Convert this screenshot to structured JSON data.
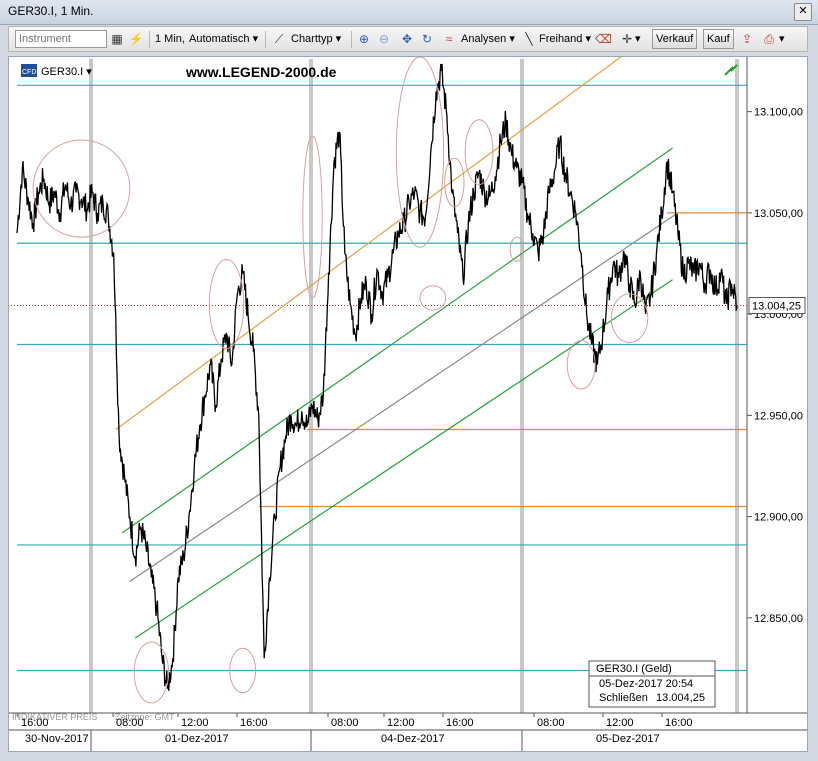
{
  "window": {
    "title": "GER30.I, 1 Min.",
    "close_glyph": "✕"
  },
  "toolbar": {
    "instrument_placeholder": "Instrument",
    "period": "1 Min,",
    "scale": "Automatisch",
    "charttype": "Charttyp",
    "analysen": "Analysen",
    "freihand": "Freihand",
    "verkauf": "Verkauf",
    "kauf": "Kauf",
    "icons": [
      "table-icon",
      "indicator-icon",
      "line-chart-icon",
      "zoom-in-icon",
      "zoom-out-icon",
      "fit-icon",
      "refresh-icon",
      "analysis-icon",
      "freehand-line-icon",
      "eraser-icon",
      "crosshair-icon",
      "export-icon",
      "print-icon"
    ]
  },
  "header": {
    "symbol": "GER30.I",
    "badge": "CFD",
    "website": "www.LEGEND-2000.de"
  },
  "footer": {
    "indicative": "INDIKATIVER PREIS",
    "timezone": "Zeitzone: GMT"
  },
  "colors": {
    "price": "#000000",
    "cyan": "#3aa7b4",
    "orange": "#e6a040",
    "green": "#21a33a",
    "grey": "#8a8a8a",
    "circle": "#d9a0a0",
    "hline_orange": "#e08a3c"
  },
  "chart_data": {
    "type": "line",
    "instrument": "GER30.I",
    "y_ticks": [
      12850,
      12900,
      12950,
      13000,
      13050,
      13100
    ],
    "y_tick_labels": [
      "12.850,00",
      "12.900,00",
      "12.950,00",
      "13.000,00",
      "13.050,00",
      "13.100,00"
    ],
    "ylim": [
      12803,
      13126
    ],
    "x_session_labels": [
      "16:00",
      "08:00",
      "12:00",
      "16:00",
      "08:00",
      "12:00",
      "16:00",
      "08:00",
      "12:00",
      "16:00"
    ],
    "date_labels": [
      "30-Nov-2017",
      "01-Dez-2017",
      "04-Dez-2017",
      "05-Dez-2017"
    ],
    "last_price": 13004.25,
    "last_price_label": "13.004,25",
    "price_path": [
      [
        0.0,
        13040
      ],
      [
        0.5,
        13072
      ],
      [
        1.0,
        13058
      ],
      [
        1.5,
        13045
      ],
      [
        2.0,
        13060
      ],
      [
        2.5,
        13067
      ],
      [
        3.0,
        13055
      ],
      [
        3.5,
        13060
      ],
      [
        4.0,
        13050
      ],
      [
        4.5,
        13064
      ],
      [
        5.0,
        13054
      ],
      [
        5.5,
        13060
      ],
      [
        6.0,
        13057
      ],
      [
        6.5,
        13052
      ],
      [
        7.0,
        13060
      ],
      [
        7.5,
        13050
      ],
      [
        8.0,
        13055
      ],
      [
        8.5,
        13048
      ],
      [
        9.0,
        13030
      ],
      [
        9.5,
        12940
      ],
      [
        10.0,
        12920
      ],
      [
        10.5,
        12900
      ],
      [
        11.0,
        12880
      ],
      [
        11.5,
        12895
      ],
      [
        12.0,
        12885
      ],
      [
        12.5,
        12870
      ],
      [
        13.0,
        12855
      ],
      [
        13.5,
        12830
      ],
      [
        14.0,
        12815
      ],
      [
        14.5,
        12830
      ],
      [
        15.0,
        12870
      ],
      [
        15.5,
        12880
      ],
      [
        16.0,
        12900
      ],
      [
        16.5,
        12925
      ],
      [
        17.0,
        12945
      ],
      [
        17.5,
        12960
      ],
      [
        18.0,
        12975
      ],
      [
        18.5,
        12955
      ],
      [
        19.0,
        12978
      ],
      [
        19.5,
        12990
      ],
      [
        20.0,
        12975
      ],
      [
        20.5,
        13010
      ],
      [
        21.0,
        13020
      ],
      [
        21.5,
        13000
      ],
      [
        22.0,
        12982
      ],
      [
        22.5,
        12950
      ],
      [
        23.0,
        12830
      ],
      [
        23.5,
        12870
      ],
      [
        24.0,
        12900
      ],
      [
        24.5,
        12925
      ],
      [
        25.0,
        12940
      ],
      [
        25.5,
        12950
      ],
      [
        26.0,
        12945
      ],
      [
        26.5,
        12952
      ],
      [
        27.0,
        12945
      ],
      [
        27.5,
        12955
      ],
      [
        28.0,
        12948
      ],
      [
        28.5,
        12960
      ],
      [
        29.0,
        13020
      ],
      [
        29.5,
        13075
      ],
      [
        30.0,
        13090
      ],
      [
        30.5,
        13030
      ],
      [
        31.0,
        13005
      ],
      [
        31.5,
        12990
      ],
      [
        32.0,
        13008
      ],
      [
        32.5,
        13015
      ],
      [
        33.0,
        13000
      ],
      [
        33.5,
        13022
      ],
      [
        34.0,
        13010
      ],
      [
        34.5,
        13018
      ],
      [
        35.0,
        13030
      ],
      [
        35.5,
        13040
      ],
      [
        36.0,
        13045
      ],
      [
        36.5,
        13055
      ],
      [
        37.0,
        13060
      ],
      [
        37.5,
        13050
      ],
      [
        38.0,
        13048
      ],
      [
        38.5,
        13080
      ],
      [
        39.0,
        13110
      ],
      [
        39.5,
        13120
      ],
      [
        40.0,
        13098
      ],
      [
        40.5,
        13060
      ],
      [
        41.0,
        13040
      ],
      [
        41.5,
        13018
      ],
      [
        42.0,
        13045
      ],
      [
        42.5,
        13060
      ],
      [
        43.0,
        13070
      ],
      [
        43.5,
        13060
      ],
      [
        44.0,
        13058
      ],
      [
        44.5,
        13068
      ],
      [
        45.0,
        13085
      ],
      [
        45.5,
        13095
      ],
      [
        46.0,
        13080
      ],
      [
        46.5,
        13072
      ],
      [
        47.0,
        13065
      ],
      [
        47.5,
        13050
      ],
      [
        48.0,
        13040
      ],
      [
        48.5,
        13030
      ],
      [
        49.0,
        13040
      ],
      [
        49.5,
        13060
      ],
      [
        50.0,
        13070
      ],
      [
        50.5,
        13085
      ],
      [
        51.0,
        13070
      ],
      [
        51.5,
        13060
      ],
      [
        52.0,
        13050
      ],
      [
        52.5,
        13030
      ],
      [
        53.0,
        13000
      ],
      [
        53.5,
        12985
      ],
      [
        54.0,
        12975
      ],
      [
        54.5,
        12990
      ],
      [
        55.0,
        13010
      ],
      [
        55.5,
        13025
      ],
      [
        56.0,
        13018
      ],
      [
        56.5,
        13030
      ],
      [
        57.0,
        13015
      ],
      [
        57.5,
        13005
      ],
      [
        58.0,
        13020
      ],
      [
        58.5,
        13000
      ],
      [
        59.0,
        13010
      ],
      [
        59.5,
        13030
      ],
      [
        60.0,
        13050
      ],
      [
        60.5,
        13075
      ],
      [
        61.0,
        13060
      ],
      [
        61.5,
        13040
      ],
      [
        62.0,
        13020
      ],
      [
        62.5,
        13025
      ],
      [
        63.0,
        13020
      ],
      [
        63.5,
        13025
      ],
      [
        64.0,
        13015
      ],
      [
        64.5,
        13022
      ],
      [
        65.0,
        13012
      ],
      [
        65.5,
        13020
      ],
      [
        66.0,
        13005
      ],
      [
        66.5,
        13015
      ],
      [
        67.0,
        13004
      ]
    ],
    "x_max": 67,
    "horizontal_lines": [
      {
        "value": 13113,
        "color": "cyan",
        "from": 0,
        "to": 67
      },
      {
        "value": 13035,
        "color": "cyan",
        "from": 0,
        "to": 67
      },
      {
        "value": 12985,
        "color": "cyan",
        "from": 0,
        "to": 67
      },
      {
        "value": 12886,
        "color": "cyan",
        "from": 0,
        "to": 67
      },
      {
        "value": 12824,
        "color": "cyan",
        "from": 0,
        "to": 67
      },
      {
        "value": 13050,
        "color": "hline_orange",
        "from": 60.5,
        "to": 67
      },
      {
        "value": 12943,
        "color": "hline_orange",
        "from": 27,
        "to": 67
      },
      {
        "value": 12905,
        "color": "hline_orange",
        "from": 22.5,
        "to": 67
      }
    ],
    "trend_lines": [
      {
        "color": "orange",
        "x1": 9.2,
        "y1": 12943,
        "x2": 59,
        "y2": 13138
      },
      {
        "color": "green",
        "x1": 9.8,
        "y1": 12892,
        "x2": 61,
        "y2": 13082
      },
      {
        "color": "grey",
        "x1": 10.5,
        "y1": 12868,
        "x2": 61.5,
        "y2": 13050
      },
      {
        "color": "green",
        "x1": 11,
        "y1": 12840,
        "x2": 61,
        "y2": 13017
      }
    ],
    "ellipses": [
      {
        "cx": 6,
        "cy": 13062,
        "rx": 4.5,
        "ry": 24
      },
      {
        "cx": 19.5,
        "cy": 13005,
        "rx": 1.6,
        "ry": 22
      },
      {
        "cx": 12.5,
        "cy": 12823,
        "rx": 1.6,
        "ry": 15
      },
      {
        "cx": 21.0,
        "cy": 12824,
        "rx": 1.2,
        "ry": 11
      },
      {
        "cx": 27.5,
        "cy": 13048,
        "rx": 0.9,
        "ry": 40
      },
      {
        "cx": 37.5,
        "cy": 13080,
        "rx": 2.2,
        "ry": 47
      },
      {
        "cx": 40.7,
        "cy": 13065,
        "rx": 0.9,
        "ry": 12
      },
      {
        "cx": 43,
        "cy": 13080,
        "rx": 1.3,
        "ry": 16
      },
      {
        "cx": 38.7,
        "cy": 13008,
        "rx": 1.2,
        "ry": 6
      },
      {
        "cx": 46.5,
        "cy": 13032,
        "rx": 0.6,
        "ry": 6
      },
      {
        "cx": 52.5,
        "cy": 12975,
        "rx": 1.3,
        "ry": 12
      },
      {
        "cx": 57.0,
        "cy": 12998,
        "rx": 1.7,
        "ry": 12
      }
    ],
    "info_box": {
      "title": "GER30.I (Geld)",
      "datetime": "05-Dez-2017 20:54",
      "label": "Schließen",
      "value": "13.004,25"
    }
  }
}
